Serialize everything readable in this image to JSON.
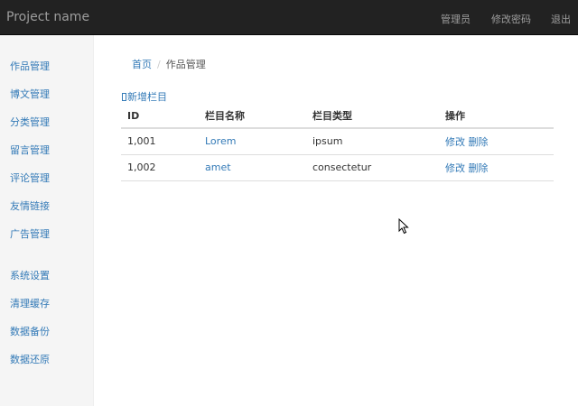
{
  "navbar": {
    "brand": "Project name",
    "links": [
      "管理员",
      "修改密码",
      "退出"
    ]
  },
  "sidebar": {
    "group1": [
      "作品管理",
      "博文管理",
      "分类管理",
      "留言管理",
      "评论管理",
      "友情链接",
      "广告管理"
    ],
    "group2": [
      "系统设置",
      "清理缓存",
      "数据备份",
      "数据还原"
    ]
  },
  "breadcrumb": {
    "home": "首页",
    "separator": "/",
    "current": "作品管理"
  },
  "toolbar": {
    "add_label": "新增栏目"
  },
  "table": {
    "columns": [
      "ID",
      "栏目名称",
      "栏目类型",
      "操作"
    ],
    "rows": [
      {
        "id": "1,001",
        "name": "Lorem",
        "type": "ipsum",
        "edit": "修改",
        "delete": "删除"
      },
      {
        "id": "1,002",
        "name": "amet",
        "type": "consectetur",
        "edit": "修改",
        "delete": "删除"
      }
    ]
  },
  "colors": {
    "navbar_bg": "#222222",
    "navbar_text": "#9d9d9d",
    "link": "#337ab7",
    "sidebar_bg": "#f5f5f5"
  }
}
